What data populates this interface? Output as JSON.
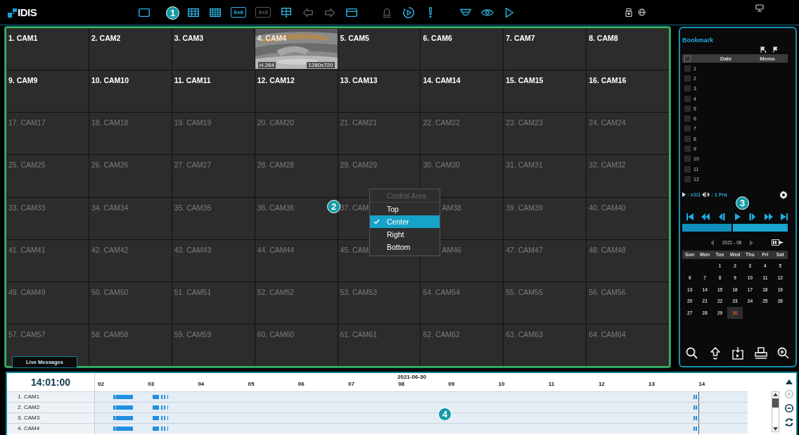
{
  "top_bar": {
    "logo": "IDIS",
    "callout": "1",
    "toolbar": [
      [
        {
          "kind": "single",
          "disabled": false
        }
      ],
      [
        {
          "kind": "grid3",
          "disabled": false
        },
        {
          "kind": "grid4",
          "disabled": false
        },
        {
          "kind": "text",
          "label": "6x6",
          "disabled": false
        },
        {
          "kind": "text",
          "label": "8x8",
          "disabled": true
        },
        {
          "kind": "custom",
          "disabled": false
        },
        {
          "kind": "prev",
          "disabled": true
        },
        {
          "kind": "next",
          "disabled": true
        },
        {
          "kind": "window",
          "disabled": false
        }
      ],
      [
        {
          "kind": "bell",
          "disabled": true
        },
        {
          "kind": "playback",
          "disabled": false
        },
        {
          "kind": "alert",
          "disabled": false
        }
      ],
      [
        {
          "kind": "dome",
          "disabled": false
        },
        {
          "kind": "eye",
          "disabled": false
        },
        {
          "kind": "play",
          "disabled": false
        }
      ]
    ]
  },
  "grid": {
    "callout": "2",
    "live_messages": "Live Messages",
    "cameras": [
      {
        "label": "1. CAM1",
        "active": true
      },
      {
        "label": "2. CAM2",
        "active": true
      },
      {
        "label": "3. CAM3",
        "active": true
      },
      {
        "label": "4. CAM4",
        "active": true,
        "kind": "picture",
        "codec": "H.264",
        "resolution": "1280x720"
      },
      {
        "label": "5. CAM5",
        "active": true
      },
      {
        "label": "6. CAM6",
        "active": true
      },
      {
        "label": "7. CAM7",
        "active": true
      },
      {
        "label": "8. CAM8",
        "active": true
      },
      {
        "label": "9. CAM9",
        "active": true
      },
      {
        "label": "10. CAM10",
        "active": true
      },
      {
        "label": "11. CAM11",
        "active": true
      },
      {
        "label": "12. CAM12",
        "active": true
      },
      {
        "label": "13. CAM13",
        "active": true
      },
      {
        "label": "14. CAM14",
        "active": true
      },
      {
        "label": "15. CAM15",
        "active": true
      },
      {
        "label": "16. CAM16",
        "active": true
      },
      {
        "label": "17. CAM17",
        "active": false
      },
      {
        "label": "18. CAM18",
        "active": false
      },
      {
        "label": "19. CAM19",
        "active": false
      },
      {
        "label": "20. CAM20",
        "active": false
      },
      {
        "label": "21. CAM21",
        "active": false
      },
      {
        "label": "22. CAM22",
        "active": false
      },
      {
        "label": "23. CAM23",
        "active": false
      },
      {
        "label": "24. CAM24",
        "active": false
      },
      {
        "label": "25. CAM25",
        "active": false
      },
      {
        "label": "26. CAM26",
        "active": false
      },
      {
        "label": "27. CAM27",
        "active": false
      },
      {
        "label": "28. CAM28",
        "active": false
      },
      {
        "label": "29. CAM29",
        "active": false
      },
      {
        "label": "30. CAM30",
        "active": false
      },
      {
        "label": "31. CAM31",
        "active": false
      },
      {
        "label": "32. CAM32",
        "active": false
      },
      {
        "label": "33. CAM33",
        "active": false
      },
      {
        "label": "34. CAM34",
        "active": false
      },
      {
        "label": "35. CAM35",
        "active": false
      },
      {
        "label": "36. CAM36",
        "active": false
      },
      {
        "label": "37. CAM",
        "active": false
      },
      {
        "label": "AM38",
        "active": false,
        "covered_start": true
      },
      {
        "label": "39. CAM39",
        "active": false
      },
      {
        "label": "40. CAM40",
        "active": false
      },
      {
        "label": "41. CAM41",
        "active": false
      },
      {
        "label": "42. CAM42",
        "active": false
      },
      {
        "label": "43. CAM43",
        "active": false
      },
      {
        "label": "44. CAM44",
        "active": false
      },
      {
        "label": "45. CAM",
        "active": false
      },
      {
        "label": "AM46",
        "active": false,
        "covered_start": true
      },
      {
        "label": "47. CAM47",
        "active": false
      },
      {
        "label": "48. CAM48",
        "active": false
      },
      {
        "label": "49. CAM49",
        "active": false
      },
      {
        "label": "50. CAM50",
        "active": false
      },
      {
        "label": "51. CAM51",
        "active": false
      },
      {
        "label": "52. CAM52",
        "active": false
      },
      {
        "label": "53. CAM53",
        "active": false
      },
      {
        "label": "54. CAM54",
        "active": false
      },
      {
        "label": "55. CAM55",
        "active": false
      },
      {
        "label": "56. CAM56",
        "active": false
      },
      {
        "label": "57. CAM57",
        "active": false
      },
      {
        "label": "58. CAM58",
        "active": false
      },
      {
        "label": "59. CAM59",
        "active": false
      },
      {
        "label": "60. CAM60",
        "active": false
      },
      {
        "label": "61. CAM61",
        "active": false
      },
      {
        "label": "62. CAM62",
        "active": false
      },
      {
        "label": "63. CAM63",
        "active": false
      },
      {
        "label": "64. CAM64",
        "active": false
      }
    ],
    "context_menu": {
      "title": "Control Area",
      "items": [
        {
          "label": "Top",
          "selected": false
        },
        {
          "label": "Center",
          "selected": true
        },
        {
          "label": "Right",
          "selected": false
        },
        {
          "label": "Bottom",
          "selected": false
        }
      ]
    }
  },
  "side_panel": {
    "title": "Bookmark",
    "callout": "3",
    "table": {
      "columns": [
        "Date",
        "Memo"
      ],
      "header_checked": false,
      "rows": [
        {
          "number": "1",
          "checked": false
        },
        {
          "number": "2",
          "checked": false
        },
        {
          "number": "3",
          "checked": false
        },
        {
          "number": "4",
          "checked": false
        },
        {
          "number": "5",
          "checked": false
        },
        {
          "number": "6",
          "checked": false
        },
        {
          "number": "7",
          "checked": false
        },
        {
          "number": "8",
          "checked": false
        },
        {
          "number": "9",
          "checked": false
        },
        {
          "number": "10",
          "checked": false
        },
        {
          "number": "11",
          "checked": false
        },
        {
          "number": "12",
          "checked": false
        }
      ]
    },
    "playback": {
      "speed": ": x1/1",
      "frame": ": 1 Fra"
    },
    "seek": {
      "level": 0.48
    },
    "calendar": {
      "month": "2021 - 06",
      "weekdays": [
        "Sun",
        "Mon",
        "Tue",
        "Wed",
        "Thu",
        "Fri",
        "Sat"
      ],
      "weeks": [
        [
          {
            "day": "1",
            "selected": false
          },
          {
            "day": "2",
            "selected": false
          },
          {
            "day": "3",
            "selected": false
          },
          {
            "day": "4",
            "selected": false
          },
          {
            "day": "5",
            "selected": false
          }
        ],
        [
          {
            "day": "6",
            "selected": false
          },
          {
            "day": "7",
            "selected": false
          },
          {
            "day": "8",
            "selected": false
          },
          {
            "day": "9",
            "selected": false
          },
          {
            "day": "10",
            "selected": false
          },
          {
            "day": "11",
            "selected": false
          },
          {
            "day": "12",
            "selected": false
          }
        ],
        [
          {
            "day": "13",
            "selected": false
          },
          {
            "day": "14",
            "selected": false
          },
          {
            "day": "15",
            "selected": false
          },
          {
            "day": "16",
            "selected": false
          },
          {
            "day": "17",
            "selected": false
          },
          {
            "day": "18",
            "selected": false
          },
          {
            "day": "19",
            "selected": false
          }
        ],
        [
          {
            "day": "20",
            "selected": false
          },
          {
            "day": "21",
            "selected": false
          },
          {
            "day": "22",
            "selected": false
          },
          {
            "day": "23",
            "selected": false
          },
          {
            "day": "24",
            "selected": false
          },
          {
            "day": "25",
            "selected": false
          },
          {
            "day": "26",
            "selected": false
          }
        ],
        [
          {
            "day": "27",
            "selected": false
          },
          {
            "day": "28",
            "selected": false
          },
          {
            "day": "29",
            "selected": false
          },
          {
            "day": "30",
            "selected": true
          }
        ]
      ]
    }
  },
  "timeline": {
    "time": "14:01:00",
    "date": "2021-06-30",
    "callout": "4",
    "hours": [
      "02",
      "03",
      "04",
      "05",
      "06",
      "07",
      "08",
      "09",
      "10",
      "11",
      "12",
      "13",
      "14"
    ],
    "channels": [
      "1. CAM1",
      "2. CAM2",
      "3. CAM3",
      "4. CAM4"
    ],
    "controls": [
      {
        "kind": "zoom-in",
        "disabled": true
      },
      {
        "kind": "zoom-out",
        "disabled": false
      },
      {
        "kind": "refresh",
        "disabled": false
      }
    ]
  }
}
